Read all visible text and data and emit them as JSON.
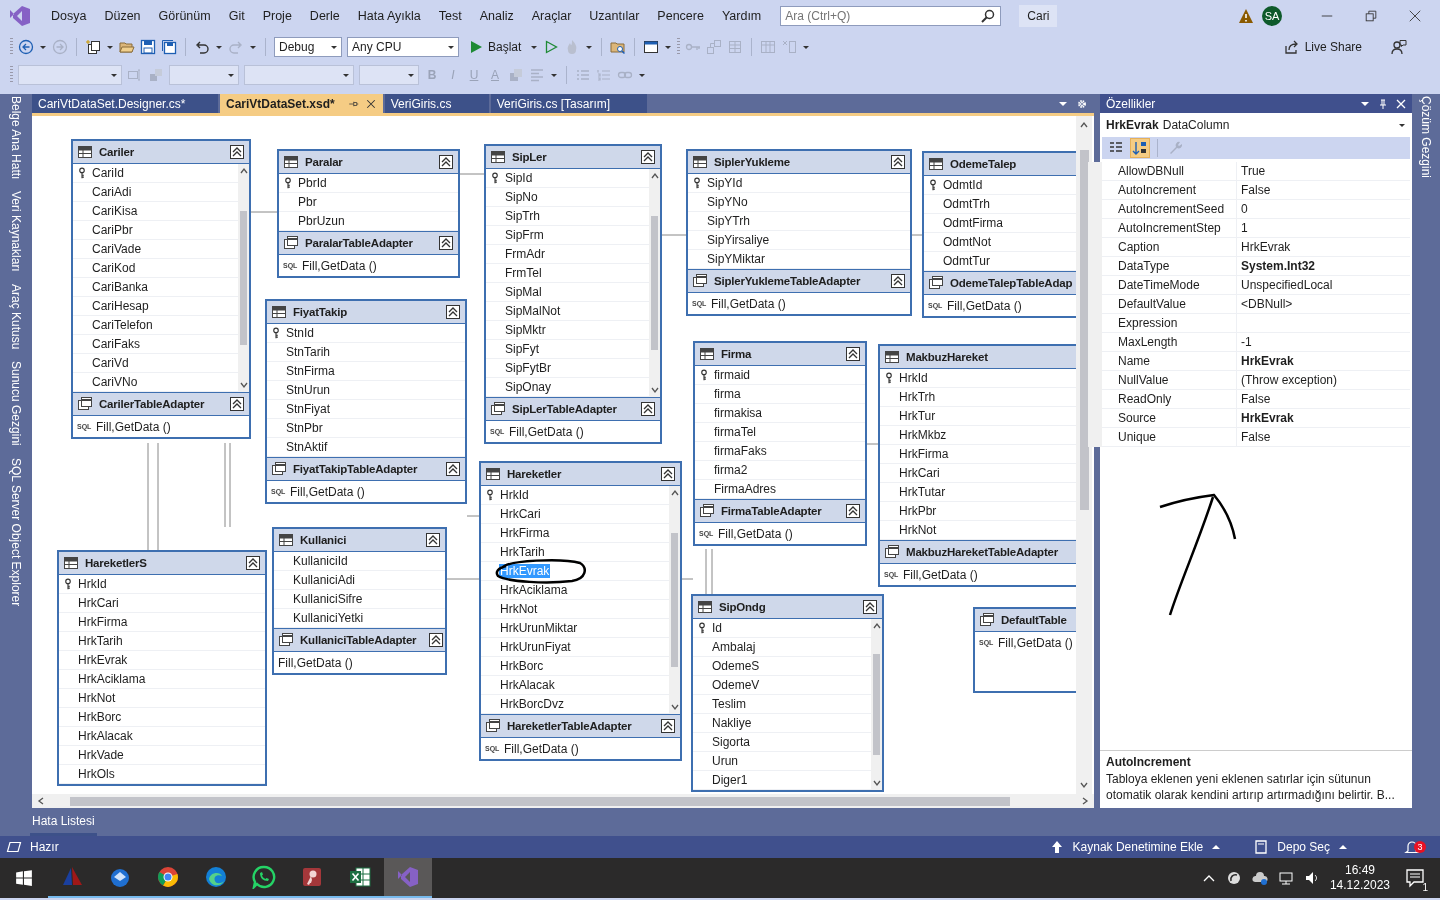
{
  "menu": [
    "Dosya",
    "Düzen",
    "Görünüm",
    "Git",
    "Proje",
    "Derle",
    "Hata Ayıkla",
    "Test",
    "Analiz",
    "Araçlar",
    "Uzantılar",
    "Pencere",
    "Yardım"
  ],
  "search": {
    "placeholder": "Ara (Ctrl+Q)"
  },
  "solution": "Cari",
  "avatar": "SA",
  "toolbar": {
    "configuration": "Debug",
    "platform": "Any CPU",
    "run": "Başlat",
    "live_share": "Live Share",
    "format_letters": [
      "B",
      "I",
      "U",
      "A"
    ]
  },
  "doc_tabs": [
    {
      "label": "CariVtDataSet.Designer.cs*",
      "selected": false
    },
    {
      "label": "CariVtDataSet.xsd*",
      "selected": true
    },
    {
      "label": "VeriGiris.cs",
      "selected": false
    },
    {
      "label": "VeriGiris.cs [Tasarım]",
      "selected": false
    }
  ],
  "left_tabs": [
    "Belge Ana Hattı",
    "Veri Kaynakları",
    "Araç Kutusu",
    "Sunucu Gezgini",
    "SQL Server Object Explorer"
  ],
  "right_tabs": [
    "Çözüm Gezgini"
  ],
  "tables": [
    {
      "name": "Cariler",
      "key_first": true,
      "scrollbar": true,
      "clipped": false,
      "fields": [
        {
          "name": "CariId",
          "selected": false
        },
        {
          "name": "CariAdi",
          "selected": false
        },
        {
          "name": "CariKisa",
          "selected": false
        },
        {
          "name": "CariPbr",
          "selected": false
        },
        {
          "name": "CariVade",
          "selected": false
        },
        {
          "name": "CariKod",
          "selected": false
        },
        {
          "name": "CariBanka",
          "selected": false
        },
        {
          "name": "CariHesap",
          "selected": false
        },
        {
          "name": "CariTelefon",
          "selected": false
        },
        {
          "name": "CariFaks",
          "selected": false
        },
        {
          "name": "CariVd",
          "selected": false
        },
        {
          "name": "CariVNo",
          "selected": false
        }
      ],
      "adapter": "CarilerTableAdapter",
      "method": {
        "badge": "SQL",
        "text": "Fill,GetData ()"
      }
    },
    {
      "name": "Paralar",
      "key_first": true,
      "scrollbar": false,
      "clipped": false,
      "fields": [
        {
          "name": "PbrId",
          "selected": false
        },
        {
          "name": "Pbr",
          "selected": false
        },
        {
          "name": "PbrUzun",
          "selected": false
        }
      ],
      "adapter": "ParalarTableAdapter",
      "method": {
        "badge": "SQL",
        "text": "Fill,GetData ()"
      }
    },
    {
      "name": "FiyatTakip",
      "key_first": true,
      "scrollbar": false,
      "clipped": false,
      "fields": [
        {
          "name": "StnId",
          "selected": false
        },
        {
          "name": "StnTarih",
          "selected": false
        },
        {
          "name": "StnFirma",
          "selected": false
        },
        {
          "name": "StnUrun",
          "selected": false
        },
        {
          "name": "StnFiyat",
          "selected": false
        },
        {
          "name": "StnPbr",
          "selected": false
        },
        {
          "name": "StnAktif",
          "selected": false
        }
      ],
      "adapter": "FiyatTakipTableAdapter",
      "method": {
        "badge": "SQL",
        "text": "Fill,GetData ()"
      }
    },
    {
      "name": "SipLer",
      "key_first": true,
      "scrollbar": true,
      "clipped": false,
      "fields": [
        {
          "name": "SipId",
          "selected": false
        },
        {
          "name": "SipNo",
          "selected": false
        },
        {
          "name": "SipTrh",
          "selected": false
        },
        {
          "name": "SipFrm",
          "selected": false
        },
        {
          "name": "FrmAdr",
          "selected": false
        },
        {
          "name": "FrmTel",
          "selected": false
        },
        {
          "name": "SipMal",
          "selected": false
        },
        {
          "name": "SipMalNot",
          "selected": false
        },
        {
          "name": "SipMktr",
          "selected": false
        },
        {
          "name": "SipFyt",
          "selected": false
        },
        {
          "name": "SipFytBr",
          "selected": false
        },
        {
          "name": "SipOnay",
          "selected": false
        }
      ],
      "adapter": "SipLerTableAdapter",
      "method": {
        "badge": "SQL",
        "text": "Fill,GetData ()"
      }
    },
    {
      "name": "SiplerYukleme",
      "key_first": true,
      "scrollbar": false,
      "clipped": false,
      "fields": [
        {
          "name": "SipYId",
          "selected": false
        },
        {
          "name": "SipYNo",
          "selected": false
        },
        {
          "name": "SipYTrh",
          "selected": false
        },
        {
          "name": "SipYirsaliye",
          "selected": false
        },
        {
          "name": "SipYMiktar",
          "selected": false
        }
      ],
      "adapter": "SiplerYuklemeTableAdapter",
      "method": {
        "badge": "SQL",
        "text": "Fill,GetData ()"
      }
    },
    {
      "name": "OdemeTalep",
      "key_first": true,
      "scrollbar": false,
      "clipped": true,
      "fields": [
        {
          "name": "OdmtId",
          "selected": false
        },
        {
          "name": "OdmtTrh",
          "selected": false
        },
        {
          "name": "OdmtFirma",
          "selected": false
        },
        {
          "name": "OdmtNot",
          "selected": false
        },
        {
          "name": "OdmtTur",
          "selected": false
        }
      ],
      "adapter": "OdemeTalepTableAdap",
      "method": {
        "badge": "SQL",
        "text": "Fill,GetData ()"
      }
    },
    {
      "name": "Firma",
      "key_first": true,
      "scrollbar": false,
      "clipped": false,
      "fields": [
        {
          "name": "firmaid",
          "selected": false
        },
        {
          "name": "firma",
          "selected": false
        },
        {
          "name": "firmakisa",
          "selected": false
        },
        {
          "name": "firmaTel",
          "selected": false
        },
        {
          "name": "firmaFaks",
          "selected": false
        },
        {
          "name": "firma2",
          "selected": false
        },
        {
          "name": "FirmaAdres",
          "selected": false
        }
      ],
      "adapter": "FirmaTableAdapter",
      "method": {
        "badge": "SQL",
        "text": "Fill,GetData ()"
      }
    },
    {
      "name": "MakbuzHareket",
      "key_first": true,
      "scrollbar": false,
      "clipped": true,
      "fields": [
        {
          "name": "HrkId",
          "selected": false
        },
        {
          "name": "HrkTrh",
          "selected": false
        },
        {
          "name": "HrkTur",
          "selected": false
        },
        {
          "name": "HrkMkbz",
          "selected": false
        },
        {
          "name": "HrkFirma",
          "selected": false
        },
        {
          "name": "HrkCari",
          "selected": false
        },
        {
          "name": "HrkTutar",
          "selected": false
        },
        {
          "name": "HrkPbr",
          "selected": false
        },
        {
          "name": "HrkNot",
          "selected": false
        }
      ],
      "adapter": "MakbuzHareketTableAdapter",
      "method": {
        "badge": "SQL",
        "text": "Fill,GetData ()"
      }
    },
    {
      "name": "Hareketler",
      "key_first": true,
      "scrollbar": true,
      "clipped": false,
      "fields": [
        {
          "name": "HrkId",
          "selected": false
        },
        {
          "name": "HrkCari",
          "selected": false
        },
        {
          "name": "HrkFirma",
          "selected": false
        },
        {
          "name": "HrkTarih",
          "selected": false
        },
        {
          "name": "HrkEvrak",
          "selected": true
        },
        {
          "name": "HrkAciklama",
          "selected": false
        },
        {
          "name": "HrkNot",
          "selected": false
        },
        {
          "name": "HrkUrunMiktar",
          "selected": false
        },
        {
          "name": "HrkUrunFiyat",
          "selected": false
        },
        {
          "name": "HrkBorc",
          "selected": false
        },
        {
          "name": "HrkAlacak",
          "selected": false
        },
        {
          "name": "HrkBorcDvz",
          "selected": false
        }
      ],
      "adapter": "HareketlerTableAdapter",
      "method": {
        "badge": "SQL",
        "text": "Fill,GetData ()"
      }
    },
    {
      "name": "HareketlerS",
      "key_first": true,
      "scrollbar": false,
      "clipped": false,
      "fields": [
        {
          "name": "HrkId",
          "selected": false
        },
        {
          "name": "HrkCari",
          "selected": false
        },
        {
          "name": "HrkFirma",
          "selected": false
        },
        {
          "name": "HrkTarih",
          "selected": false
        },
        {
          "name": "HrkEvrak",
          "selected": false
        },
        {
          "name": "HrkAciklama",
          "selected": false
        },
        {
          "name": "HrkNot",
          "selected": false
        },
        {
          "name": "HrkBorc",
          "selected": false
        },
        {
          "name": "HrkAlacak",
          "selected": false
        },
        {
          "name": "HrkVade",
          "selected": false
        },
        {
          "name": "HrkOls",
          "selected": false
        }
      ]
    },
    {
      "name": "Kullanici",
      "key_first": false,
      "scrollbar": false,
      "clipped": false,
      "fields": [
        {
          "name": "KullaniciId",
          "selected": false
        },
        {
          "name": "KullaniciAdi",
          "selected": false
        },
        {
          "name": "KullaniciSifre",
          "selected": false
        },
        {
          "name": "KullaniciYetki",
          "selected": false
        }
      ],
      "adapter": "KullaniciTableAdapter",
      "method": {
        "text": "Fill,GetData ()"
      }
    },
    {
      "name": "SipOndg",
      "key_first": true,
      "scrollbar": true,
      "clipped": false,
      "fields": [
        {
          "name": "Id",
          "selected": false
        },
        {
          "name": "Ambalaj",
          "selected": false
        },
        {
          "name": "OdemeS",
          "selected": false
        },
        {
          "name": "OdemeV",
          "selected": false
        },
        {
          "name": "Teslim",
          "selected": false
        },
        {
          "name": "Nakliye",
          "selected": false
        },
        {
          "name": "Sigorta",
          "selected": false
        },
        {
          "name": "Urun",
          "selected": false
        },
        {
          "name": "Diger1",
          "selected": false
        }
      ]
    },
    {
      "name": "DefaultTable",
      "kind": "adapter_only",
      "clipped": true,
      "method": {
        "badge": "SQL",
        "text": "Fill,GetData ()"
      }
    }
  ],
  "properties": {
    "title": "Özellikler",
    "object_name": "HrkEvrak",
    "object_type": "DataColumn",
    "rows": [
      {
        "name": "AllowDBNull",
        "value": "True",
        "bold": false
      },
      {
        "name": "AutoIncrement",
        "value": "False",
        "bold": false
      },
      {
        "name": "AutoIncrementSeed",
        "value": "0",
        "bold": false
      },
      {
        "name": "AutoIncrementStep",
        "value": "1",
        "bold": false
      },
      {
        "name": "Caption",
        "value": "HrkEvrak",
        "bold": false
      },
      {
        "name": "DataType",
        "value": "System.Int32",
        "bold": true
      },
      {
        "name": "DateTimeMode",
        "value": "UnspecifiedLocal",
        "bold": false
      },
      {
        "name": "DefaultValue",
        "value": "<DBNull>",
        "bold": false
      },
      {
        "name": "Expression"
      },
      {
        "name": "MaxLength",
        "value": "-1",
        "bold": false
      },
      {
        "name": "Name",
        "value": "HrkEvrak",
        "bold": true
      },
      {
        "name": "NullValue",
        "value": "(Throw exception)",
        "bold": false
      },
      {
        "name": "ReadOnly",
        "value": "False",
        "bold": false
      },
      {
        "name": "Source",
        "value": "HrkEvrak",
        "bold": true
      },
      {
        "name": "Unique",
        "value": "False",
        "bold": false
      }
    ],
    "description_title": "AutoIncrement",
    "description": "Tabloya eklenen yeni eklenen satırlar için sütunun otomatik olarak kendini artırıp artırmadığını belirtir. B..."
  },
  "bottom_tab": "Hata Listesi",
  "status": {
    "text": "Hazır",
    "source_control": "Kaynak Denetimine Ekle",
    "repository": "Depo Seç",
    "notifications": "3"
  },
  "taskbar": {
    "time": "16:49",
    "date": "14.12.2023",
    "action_center": "1"
  }
}
